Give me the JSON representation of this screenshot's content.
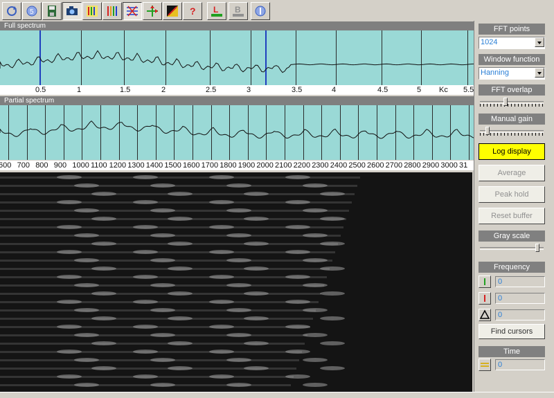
{
  "toolbar": {
    "buttons": [
      "refresh-icon",
      "sync-5-icon",
      "save-disk-icon",
      "camera-icon",
      "color-bars-icon",
      "spectrum-bars-icon",
      "grid-x-icon",
      "crosshair-icon",
      "contrast-icon",
      "help-icon",
      "layer-l-icon",
      "layer-b-icon",
      "info-icon"
    ],
    "labels": {
      "help": "?",
      "layer_l": "L",
      "layer_b": "B"
    }
  },
  "full_spectrum": {
    "title": "Full spectrum",
    "axis_ticks": [
      "0.5",
      "1",
      "1.5",
      "2",
      "2.5",
      "3",
      "3.5",
      "4",
      "4.5",
      "5",
      "Kc",
      "5.5"
    ]
  },
  "partial_spectrum": {
    "title": "Partial spectrum",
    "axis_ticks": [
      "600",
      "700",
      "800",
      "900",
      "1000",
      "1100",
      "1200",
      "1300",
      "1400",
      "1500",
      "1600",
      "1700",
      "1800",
      "1900",
      "2000",
      "2100",
      "2200",
      "2300",
      "2400",
      "2500",
      "2600",
      "2700",
      "2800",
      "2900",
      "3000",
      "31"
    ]
  },
  "sidebar": {
    "fft_points": {
      "title": "FFT points",
      "value": "1024"
    },
    "window_function": {
      "title": "Window function",
      "value": "Hanning"
    },
    "fft_overlap": {
      "title": "FFT overlap",
      "level": 0.4
    },
    "manual_gain": {
      "title": "Manual gain",
      "level": 0.1
    },
    "log_display": "Log display",
    "average": "Average",
    "peak_hold": "Peak hold",
    "reset_buffer": "Reset buffer",
    "gray_scale": {
      "title": "Gray scale",
      "level": 0.95
    },
    "frequency": {
      "title": "Frequency",
      "cursor1": "0",
      "cursor2": "0",
      "delta": "0",
      "find_cursors": "Find cursors"
    },
    "time": {
      "title": "Time",
      "value": "0"
    }
  },
  "colors": {
    "plot_bg": "#9ad9d6",
    "cursor": "#1f3fbf",
    "log_display_bg": "#ffff00",
    "value_text": "#2a7fd6"
  }
}
